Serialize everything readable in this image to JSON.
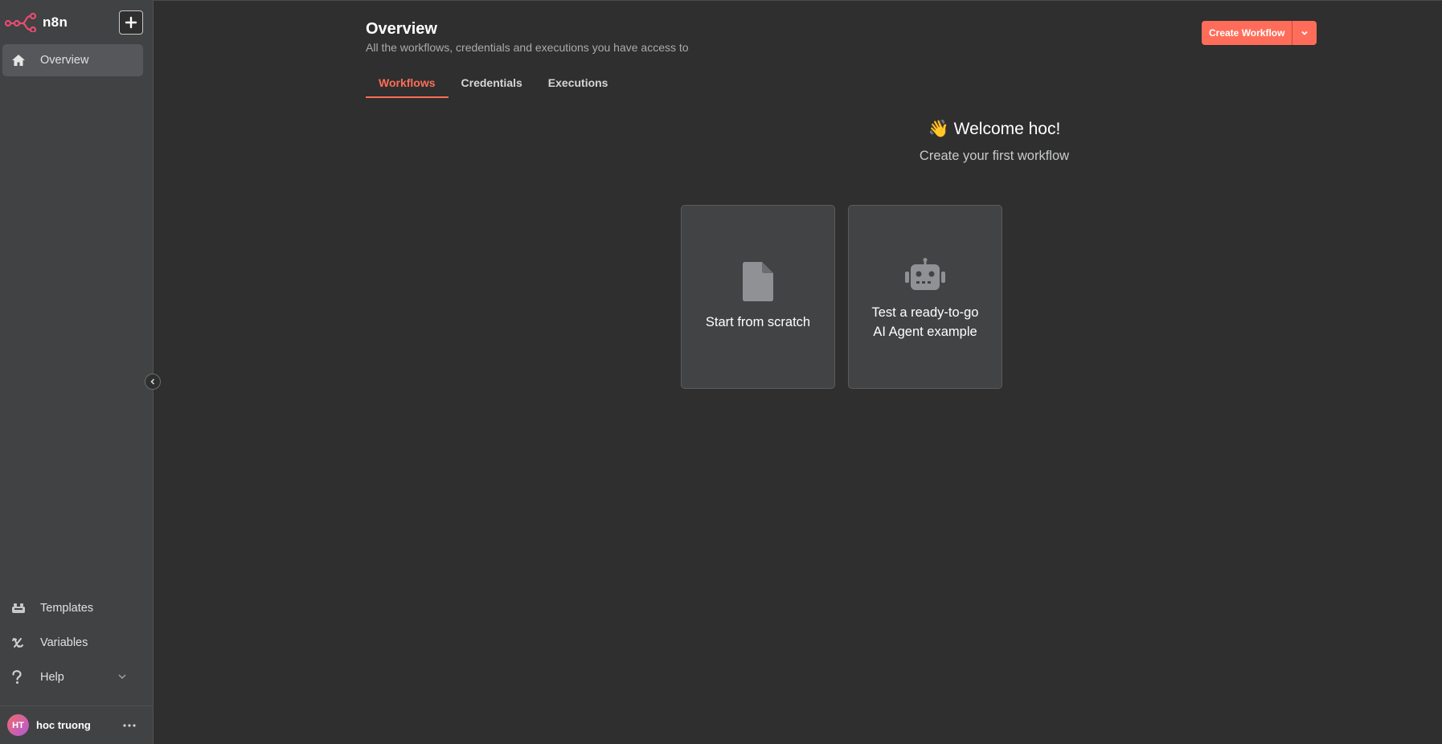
{
  "sidebar": {
    "logo_text": "n8n",
    "items": [
      {
        "label": "Overview",
        "icon": "home-icon"
      },
      {
        "label": "Templates",
        "icon": "templates-icon"
      },
      {
        "label": "Variables",
        "icon": "variables-icon"
      },
      {
        "label": "Help",
        "icon": "help-icon"
      }
    ],
    "user": {
      "initials": "HT",
      "name": "hoc truong"
    }
  },
  "header": {
    "title": "Overview",
    "subtitle": "All the workflows, credentials and executions you have access to",
    "create_label": "Create Workflow"
  },
  "tabs": [
    {
      "label": "Workflows",
      "active": true
    },
    {
      "label": "Credentials",
      "active": false
    },
    {
      "label": "Executions",
      "active": false
    }
  ],
  "welcome": {
    "title": "👋 Welcome hoc!",
    "subtitle": "Create your first workflow"
  },
  "cards": [
    {
      "label": "Start from scratch",
      "icon": "file-icon"
    },
    {
      "label_line1": "Test a ready-to-go",
      "label_line2": "AI Agent example",
      "icon": "robot-icon"
    }
  ],
  "colors": {
    "accent": "#ff6d5a",
    "sidebar_bg": "#414244",
    "main_bg": "#2e2f2e",
    "card_bg": "#424345"
  }
}
